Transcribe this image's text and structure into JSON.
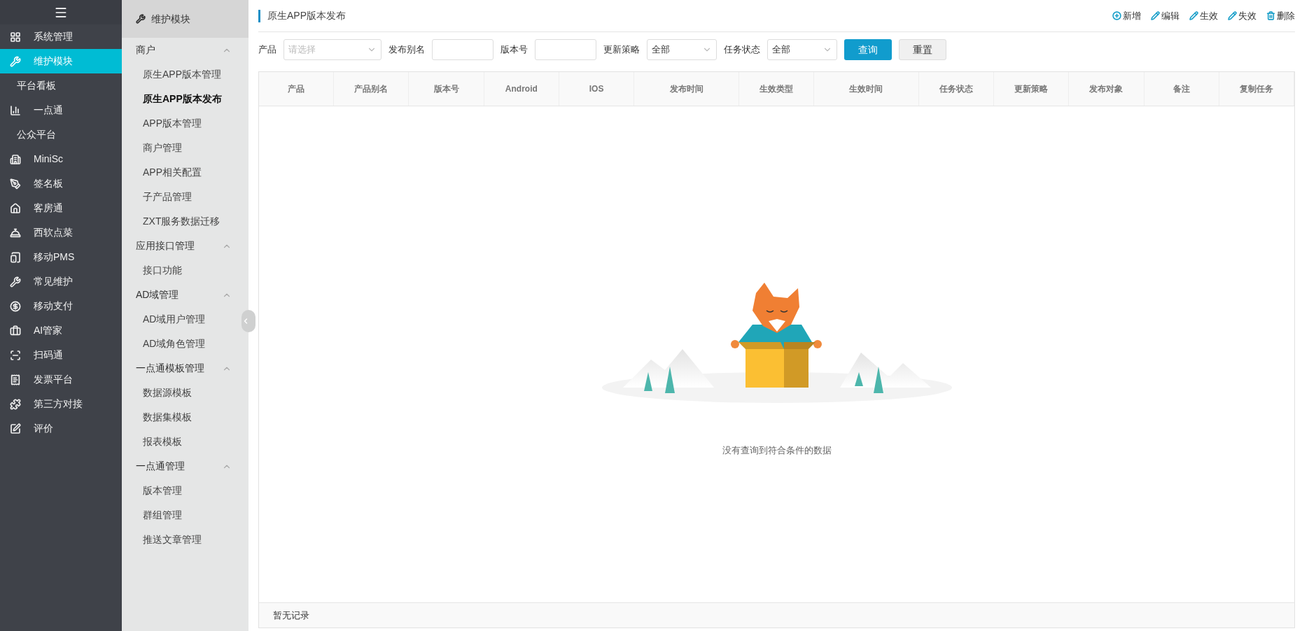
{
  "nav": {
    "items": [
      {
        "label": "系统管理",
        "kind": "icon",
        "selected": false
      },
      {
        "label": "维护模块",
        "kind": "icon",
        "selected": true
      },
      {
        "label": "平台看板",
        "kind": "sub",
        "selected": false
      },
      {
        "label": "一点通",
        "kind": "icon",
        "selected": false
      },
      {
        "label": "公众平台",
        "kind": "sub",
        "selected": false
      },
      {
        "label": "MiniSc",
        "kind": "icon",
        "selected": false
      },
      {
        "label": "签名板",
        "kind": "icon",
        "selected": false
      },
      {
        "label": "客房通",
        "kind": "icon",
        "selected": false
      },
      {
        "label": "西软点菜",
        "kind": "icon",
        "selected": false
      },
      {
        "label": "移动PMS",
        "kind": "icon",
        "selected": false
      },
      {
        "label": "常见维护",
        "kind": "icon",
        "selected": false
      },
      {
        "label": "移动支付",
        "kind": "icon",
        "selected": false
      },
      {
        "label": "AI管家",
        "kind": "icon",
        "selected": false
      },
      {
        "label": "扫码通",
        "kind": "icon",
        "selected": false
      },
      {
        "label": "发票平台",
        "kind": "icon",
        "selected": false
      },
      {
        "label": "第三方对接",
        "kind": "icon",
        "selected": false
      },
      {
        "label": "评价",
        "kind": "icon",
        "selected": false
      }
    ]
  },
  "submenu": {
    "title": "维护模块",
    "groups": [
      {
        "label": "商户",
        "expanded": true,
        "children": [
          {
            "label": "原生APP版本管理",
            "selected": false
          },
          {
            "label": "原生APP版本发布",
            "selected": true
          },
          {
            "label": "APP版本管理",
            "selected": false
          },
          {
            "label": "商户管理",
            "selected": false
          },
          {
            "label": "APP相关配置",
            "selected": false
          },
          {
            "label": "子产品管理",
            "selected": false
          },
          {
            "label": "ZXT服务数据迁移",
            "selected": false
          }
        ]
      },
      {
        "label": "应用接口管理",
        "expanded": true,
        "children": [
          {
            "label": "接口功能",
            "selected": false
          }
        ]
      },
      {
        "label": "AD域管理",
        "expanded": true,
        "children": [
          {
            "label": "AD域用户管理",
            "selected": false
          },
          {
            "label": "AD域角色管理",
            "selected": false
          }
        ]
      },
      {
        "label": "一点通模板管理",
        "expanded": true,
        "children": [
          {
            "label": "数据源模板",
            "selected": false
          },
          {
            "label": "数据集模板",
            "selected": false
          },
          {
            "label": "报表模板",
            "selected": false
          }
        ]
      },
      {
        "label": "一点通管理",
        "expanded": true,
        "children": [
          {
            "label": "版本管理",
            "selected": false
          },
          {
            "label": "群组管理",
            "selected": false
          },
          {
            "label": "推送文章管理",
            "selected": false
          }
        ]
      }
    ]
  },
  "page": {
    "title": "原生APP版本发布",
    "actions": [
      {
        "label": "新增",
        "kind": "add"
      },
      {
        "label": "编辑",
        "kind": "edit"
      },
      {
        "label": "生效",
        "kind": "edit"
      },
      {
        "label": "失效",
        "kind": "edit"
      },
      {
        "label": "删除",
        "kind": "delete"
      }
    ],
    "filters": [
      {
        "label": "产品",
        "kind": "select",
        "placeholder": "请选择"
      },
      {
        "label": "发布别名",
        "kind": "input"
      },
      {
        "label": "版本号",
        "kind": "input"
      },
      {
        "label": "更新策略",
        "kind": "select",
        "value": "全部"
      },
      {
        "label": "任务状态",
        "kind": "select",
        "value": "全部"
      }
    ],
    "buttons": [
      {
        "label": "查询",
        "kind": "primary"
      },
      {
        "label": "重置",
        "kind": "default"
      }
    ],
    "table": {
      "columns": [
        "产品",
        "产品别名",
        "版本号",
        "Android",
        "IOS",
        "发布时间",
        "生效类型",
        "生效时间",
        "任务状态",
        "更新策略",
        "发布对象",
        "备注",
        "复制任务"
      ],
      "empty_text": "没有查询到符合条件的数据",
      "footer": "暂无记录"
    }
  }
}
